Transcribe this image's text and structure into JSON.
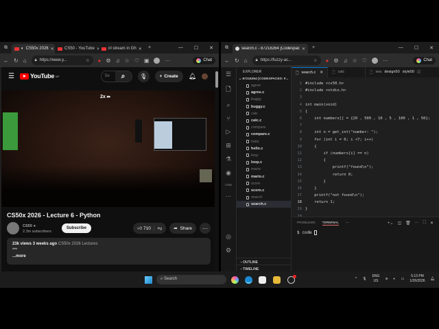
{
  "left_browser": {
    "tabs": [
      {
        "label": "CS50x 2026",
        "active": true
      },
      {
        "label": "CS50 - YouTube"
      },
      {
        "label": "irl stream in Gh"
      }
    ],
    "url": "https://www.y...",
    "chat_label": "Chat",
    "youtube": {
      "logo": "YouTube",
      "logo_region": "MP",
      "search_placeholder": "Se",
      "create_label": "Create",
      "speed_overlay": "2x",
      "video_title": "CS50x 2026 - Lecture 6 - Python",
      "channel_name": "CS50",
      "subscribers": "2.3m subscribers",
      "subscribe_label": "Subscribe",
      "likes": "710",
      "share_label": "Share",
      "views": "23k views",
      "age": "3 weeks ago",
      "playlist": "CS50x 2026 Lectures",
      "desc_line": "***",
      "more_label": "...more"
    }
  },
  "right_browser": {
    "tabs": [
      {
        "label": "search.c - 87218264 [Codespaces:",
        "active": true
      }
    ],
    "url": "https://fuzzy-ac...",
    "chat_label": "Chat",
    "vscode": {
      "explorer_title": "EXPLORER",
      "root": "87218264 [CODESPACES: F...",
      "files": [
        {
          "name": "agree",
          "type": "bin"
        },
        {
          "name": "agree.c",
          "type": "c"
        },
        {
          "name": "buggy",
          "type": "bin"
        },
        {
          "name": "buggy.c",
          "type": "c"
        },
        {
          "name": "calc",
          "type": "bin"
        },
        {
          "name": "calc.c",
          "type": "c"
        },
        {
          "name": "compare",
          "type": "bin"
        },
        {
          "name": "compare.c",
          "type": "c"
        },
        {
          "name": "hello",
          "type": "bin"
        },
        {
          "name": "hello.c",
          "type": "c"
        },
        {
          "name": "loop",
          "type": "bin"
        },
        {
          "name": "loop.c",
          "type": "c"
        },
        {
          "name": "mario",
          "type": "bin"
        },
        {
          "name": "mario.c",
          "type": "c"
        },
        {
          "name": "score",
          "type": "bin"
        },
        {
          "name": "score.c",
          "type": "c"
        },
        {
          "name": "search",
          "type": "bin"
        },
        {
          "name": "search.c",
          "type": "c",
          "selected": true
        }
      ],
      "outline_label": "OUTLINE",
      "timeline_label": "TIMELINE",
      "cs50_label": "CS50",
      "editor_tabs": [
        "search.c",
        "calc",
        "sea",
        "design50",
        "style50"
      ],
      "code_lines": [
        "#include <cs50.h>",
        "#include <stdio.h>",
        "",
        "int main(void)",
        "{",
        "    int numbers[] = {20 , 500 , 10 , 5 , 100 , 1 , 50};",
        "",
        "    int n = get_int(\"number: \");",
        "    for (int i = 0; i <7; i++)",
        "    {",
        "        if (numbers[i] == n)",
        "        {",
        "            printf(\"found\\n\");",
        "            return 0;",
        "        }",
        "    }",
        "    printf(\"not found\\n\");",
        "    return 1;",
        "}",
        ""
      ],
      "line_numbers": [
        "1",
        "2",
        "3",
        "4",
        "5",
        "6",
        "7",
        "8",
        "9",
        "10",
        "11",
        "12",
        "13",
        "14",
        "15",
        "16",
        "17",
        "18",
        "19",
        "20"
      ],
      "current_line": 18,
      "panel_tabs": [
        "PROBLEMS",
        "TERMINAL"
      ],
      "terminal_prompt": "$ code "
    }
  },
  "taskbar": {
    "search_label": "Search",
    "lang": "ENG",
    "region": "US",
    "time": "5:13 PM",
    "date": "1/26/2026"
  }
}
